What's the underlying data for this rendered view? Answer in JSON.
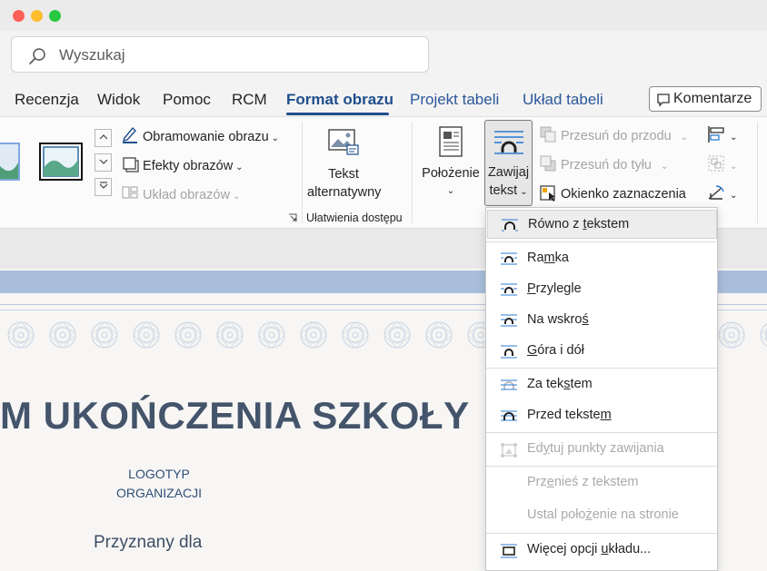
{
  "search": {
    "placeholder": "Wyszukaj"
  },
  "tabs": [
    {
      "label": "Recenzja",
      "state": "normal"
    },
    {
      "label": "Widok",
      "state": "normal"
    },
    {
      "label": "Pomoc",
      "state": "normal"
    },
    {
      "label": "RCM",
      "state": "normal"
    },
    {
      "label": "Format obrazu",
      "state": "active"
    },
    {
      "label": "Projekt tabeli",
      "state": "contextual"
    },
    {
      "label": "Układ tabeli",
      "state": "contextual"
    }
  ],
  "comments_button": {
    "label": "Komentarze"
  },
  "ribbon": {
    "picture_styles": {
      "border": "Obramowanie obrazu",
      "effects": "Efekty obrazów",
      "layout": "Układ obrazów"
    },
    "alt_text": {
      "line1": "Tekst",
      "line2": "alternatywny"
    },
    "accessibility_group": "Ułatwienia dostępu",
    "position": {
      "label": "Położenie"
    },
    "wrap_text": {
      "line1": "Zawijaj",
      "line2": "tekst"
    },
    "arrange": {
      "bring_forward": "Przesuń do przodu",
      "send_backward": "Przesuń do tyłu",
      "selection_pane": "Okienko zaznaczenia"
    }
  },
  "wrap_menu": {
    "groups": [
      [
        {
          "pre": "Równo z ",
          "key": "t",
          "post": "ekstem",
          "disabled": false,
          "highlighted": true
        }
      ],
      [
        {
          "pre": "Ra",
          "key": "m",
          "post": "ka",
          "disabled": false
        },
        {
          "pre": "",
          "key": "P",
          "post": "rzylegle",
          "disabled": false
        },
        {
          "pre": "Na wskro",
          "key": "ś",
          "post": "",
          "disabled": false
        },
        {
          "pre": "",
          "key": "G",
          "post": "óra i dół",
          "disabled": false
        }
      ],
      [
        {
          "pre": "Za tek",
          "key": "s",
          "post": "tem",
          "disabled": false
        },
        {
          "pre": "Przed tekste",
          "key": "m",
          "post": "",
          "disabled": false
        }
      ],
      [
        {
          "pre": "Ed",
          "key": "y",
          "post": "tuj punkty zawijania",
          "disabled": true
        }
      ],
      [
        {
          "pre": "Prz",
          "key": "e",
          "post": "nieś z tekstem",
          "disabled": true
        },
        {
          "pre": "Ustal poło",
          "key": "ż",
          "post": "enie na stronie",
          "disabled": true
        }
      ],
      [
        {
          "pre": "Więcej opcji ",
          "key": "u",
          "post": "kładu...",
          "disabled": false
        }
      ]
    ]
  },
  "document": {
    "title": "M UKOŃCZENIA SZKOŁY",
    "logo_line1": "LOGOTYP",
    "logo_line2": "ORGANIZACJI",
    "awarded_to": "Przyznany dla"
  },
  "colors": {
    "accent": "#1f4e8c",
    "contextual_tab": "#2b579a",
    "doc_title": "#44546a",
    "page_band": "#a9bedb"
  }
}
